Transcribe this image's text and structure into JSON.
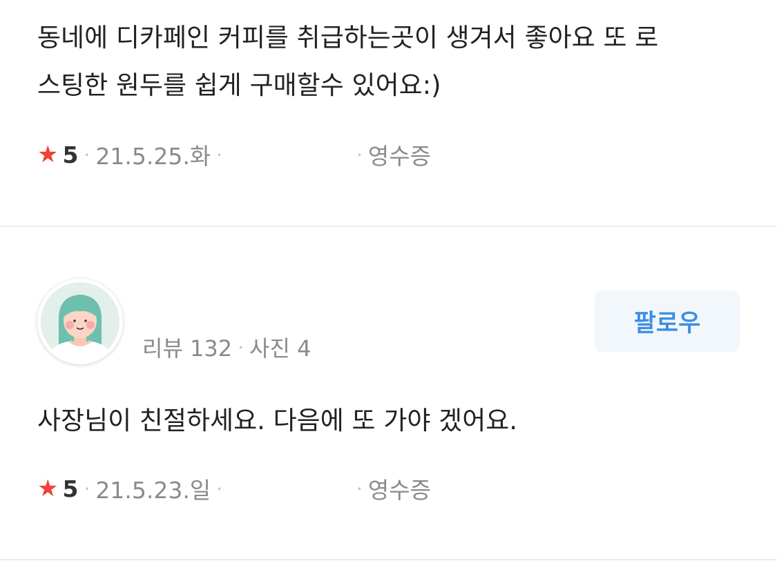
{
  "review1": {
    "text_line1": "동네에 디카페인 커피를 취급하는곳이 생겨서 좋아요 또 로",
    "text_line2": "스팅한 원두를 쉽게 구매할수 있어요:)",
    "rating": "5",
    "date": "21.5.25.화",
    "receipt_label": "영수증"
  },
  "review2": {
    "author_reviews": "리뷰 132",
    "author_photos": "사진 4",
    "follow_label": "팔로우",
    "text": "사장님이 친절하세요. 다음에 또 가야 겠어요.",
    "rating": "5",
    "date": "21.5.23.일",
    "receipt_label": "영수증"
  },
  "icons": {
    "star": "star-icon",
    "avatar": "user-avatar-illustration"
  },
  "colors": {
    "star": "#f0433a",
    "follow_text": "#3c8fe3",
    "follow_bg": "#f2f7fc",
    "meta_text": "#8a8a8a",
    "divider": "#ececec"
  }
}
